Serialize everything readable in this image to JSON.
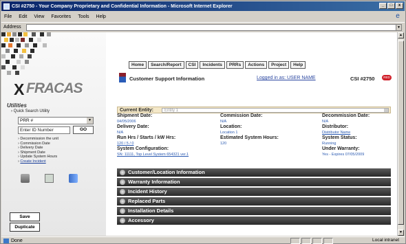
{
  "window": {
    "title": "CSI #2750 - Your Company Proprietary and Confidential Information - Microsoft Internet Explorer"
  },
  "menu": [
    "File",
    "Edit",
    "View",
    "Favorites",
    "Tools",
    "Help"
  ],
  "address": {
    "label": "Address",
    "value": ""
  },
  "logo": {
    "text": "FRACAS",
    "prefix": "X"
  },
  "utilities": {
    "title": "Utilities",
    "quick_search": "Quick Search Utility",
    "select_value": "PRR #",
    "id_placeholder": "Enter ID Number",
    "go_label": "GO",
    "links": [
      "Decommission the unit",
      "Commission Date",
      "Delivery Date",
      "Shipment Date",
      "Update System Hours",
      "Create Incident"
    ]
  },
  "actions": {
    "save": "Save",
    "duplicate": "Duplicate"
  },
  "nav": [
    "Home",
    "Search/Report",
    "CSI",
    "Incidents",
    "PRRs",
    "Actions",
    "Project",
    "Help"
  ],
  "header": {
    "title": "Customer Support Information",
    "login": "Logged in as: USER NAME",
    "csi": "CSI #2750",
    "badge": "RED"
  },
  "current_entity": {
    "label": "Current Entity:",
    "value": "Entity 1"
  },
  "info": {
    "shipment_date_label": "Shipment Date:",
    "shipment_date_value": "04/05/2006",
    "commission_date_label": "Commission Date:",
    "commission_date_value": "N/A",
    "decommission_date_label": "Decommission Date:",
    "decommission_date_value": "N/A",
    "delivery_date_label": "Delivery Date:",
    "delivery_date_value": "N/A",
    "location_label": "Location:",
    "location_value": "Location 1",
    "distributor_label": "Distributor:",
    "distributor_value": "Distributor Name",
    "run_hrs_label": "Run Hrs / Starts / kW Hrs:",
    "run_hrs_value": "120 / 5 / 0",
    "est_hours_label": "Estimated System Hours:",
    "est_hours_value": "120",
    "system_status_label": "System Status:",
    "system_status_value": "Running",
    "sys_config_label": "System Configuration:",
    "sys_config_value": "SN: 11111, Top Level System 654321 ver.1",
    "warranty_label": "Under Warranty:",
    "warranty_value": "Yes - Expires 07/05/2009"
  },
  "sections": [
    "Customer/Location Information",
    "Warranty Information",
    "Incident History",
    "Replaced Parts",
    "Installation Details",
    "Accessory"
  ],
  "status": {
    "text": "Done",
    "zone": "Local intranet"
  }
}
